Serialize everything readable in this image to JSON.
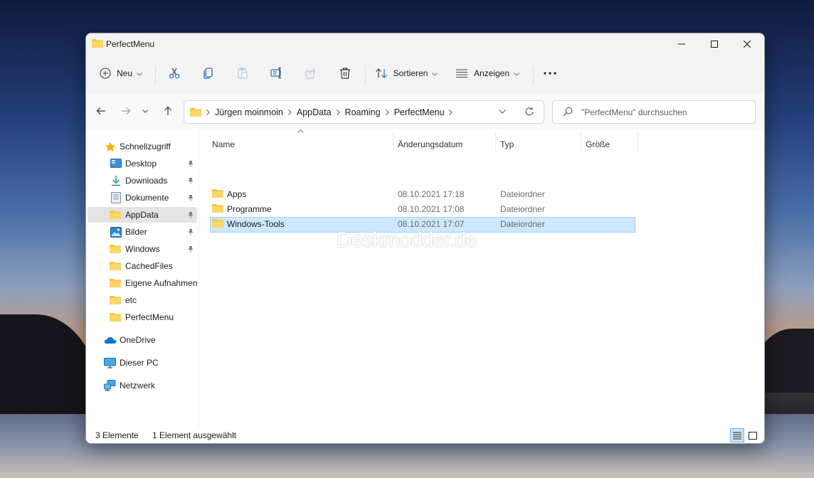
{
  "window": {
    "title": "PerfectMenu"
  },
  "toolbar": {
    "new_label": "Neu",
    "sort_label": "Sortieren",
    "view_label": "Anzeigen"
  },
  "address": {
    "crumbs": [
      "Jürgen moinmoin",
      "AppData",
      "Roaming",
      "PerfectMenu"
    ]
  },
  "search": {
    "placeholder": "\"PerfectMenu\" durchsuchen"
  },
  "sidebar": {
    "quick_access": "Schnellzugriff",
    "items": [
      {
        "label": "Desktop",
        "icon": "desktop-icon"
      },
      {
        "label": "Downloads",
        "icon": "downloads-icon"
      },
      {
        "label": "Dokumente",
        "icon": "documents-icon"
      },
      {
        "label": "AppData",
        "icon": "folder-icon"
      },
      {
        "label": "Bilder",
        "icon": "pictures-icon"
      },
      {
        "label": "Windows",
        "icon": "folder-icon"
      },
      {
        "label": "CachedFiles",
        "icon": "folder-icon"
      },
      {
        "label": "Eigene Aufnahmen",
        "icon": "folder-icon"
      },
      {
        "label": "etc",
        "icon": "folder-icon"
      },
      {
        "label": "PerfectMenu",
        "icon": "folder-icon"
      }
    ],
    "onedrive": "OneDrive",
    "thispc": "Dieser PC",
    "network": "Netzwerk"
  },
  "columns": {
    "name": "Name",
    "date": "Änderungsdatum",
    "type": "Typ",
    "size": "Größe"
  },
  "files": [
    {
      "name": "Apps",
      "date": "08.10.2021 17:18",
      "type": "Dateiordner"
    },
    {
      "name": "Programme",
      "date": "08.10.2021 17:08",
      "type": "Dateiordner"
    },
    {
      "name": "Windows-Tools",
      "date": "08.10.2021 17:07",
      "type": "Dateiordner"
    }
  ],
  "watermark": "Deskmodder.de",
  "status": {
    "count": "3 Elemente",
    "selected": "1 Element ausgewählt"
  },
  "colors": {
    "folder": "#f6c343",
    "selection": "#cde8ff",
    "accent": "#0067c0"
  }
}
